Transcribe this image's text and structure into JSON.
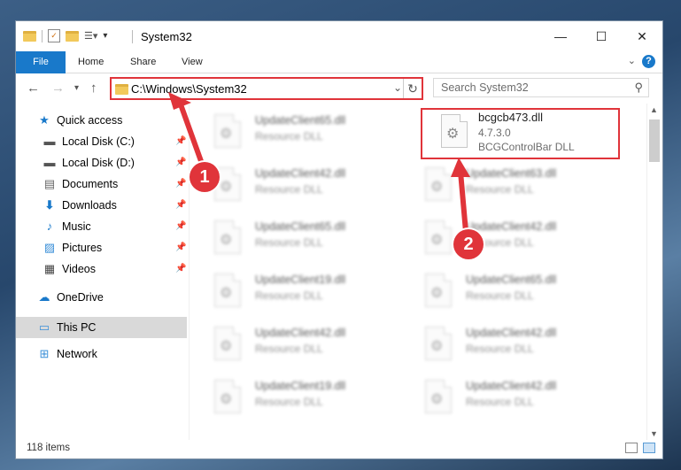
{
  "window": {
    "title": "System32",
    "minimize": "—",
    "maximize": "☐",
    "close": "✕"
  },
  "ribbon": {
    "tabs": [
      "File",
      "Home",
      "Share",
      "View"
    ],
    "help": "?"
  },
  "address": {
    "path": "C:\\Windows\\System32",
    "search_placeholder": "Search System32"
  },
  "sidebar": {
    "items": [
      {
        "label": "Quick access",
        "icon": "star-icon"
      },
      {
        "label": "Local Disk (C:)",
        "icon": "drive-icon"
      },
      {
        "label": "Local Disk (D:)",
        "icon": "drive-icon"
      },
      {
        "label": "Documents",
        "icon": "documents-icon"
      },
      {
        "label": "Downloads",
        "icon": "download-icon"
      },
      {
        "label": "Music",
        "icon": "music-icon"
      },
      {
        "label": "Pictures",
        "icon": "pictures-icon"
      },
      {
        "label": "Videos",
        "icon": "videos-icon"
      },
      {
        "label": "OneDrive",
        "icon": "cloud-icon"
      },
      {
        "label": "This PC",
        "icon": "computer-icon"
      },
      {
        "label": "Network",
        "icon": "network-icon"
      }
    ]
  },
  "files": {
    "left": [
      {
        "name": "UpdateClient65.dll",
        "desc": "Resource DLL"
      },
      {
        "name": "UpdateClient42.dll",
        "desc": "Resource DLL"
      },
      {
        "name": "UpdateClient65.dll",
        "desc": "Resource DLL"
      },
      {
        "name": "UpdateClient19.dll",
        "desc": "Resource DLL"
      },
      {
        "name": "UpdateClient42.dll",
        "desc": "Resource DLL"
      },
      {
        "name": "UpdateClient19.dll",
        "desc": "Resource DLL"
      }
    ],
    "right_highlight": {
      "name": "bcgcb473.dll",
      "version": "4.7.3.0",
      "desc": "BCGControlBar DLL"
    },
    "right": [
      {
        "name": "UpdateClient63.dll",
        "desc": "Resource DLL"
      },
      {
        "name": "UpdateClient42.dll",
        "desc": "Resource DLL"
      },
      {
        "name": "UpdateClient65.dll",
        "desc": "Resource DLL"
      },
      {
        "name": "UpdateClient42.dll",
        "desc": "Resource DLL"
      },
      {
        "name": "UpdateClient42.dll",
        "desc": "Resource DLL"
      }
    ]
  },
  "status": {
    "items_count": "118 items"
  },
  "callouts": {
    "one": "1",
    "two": "2"
  },
  "colors": {
    "accent": "#1979ca",
    "highlight": "#e0343a"
  }
}
